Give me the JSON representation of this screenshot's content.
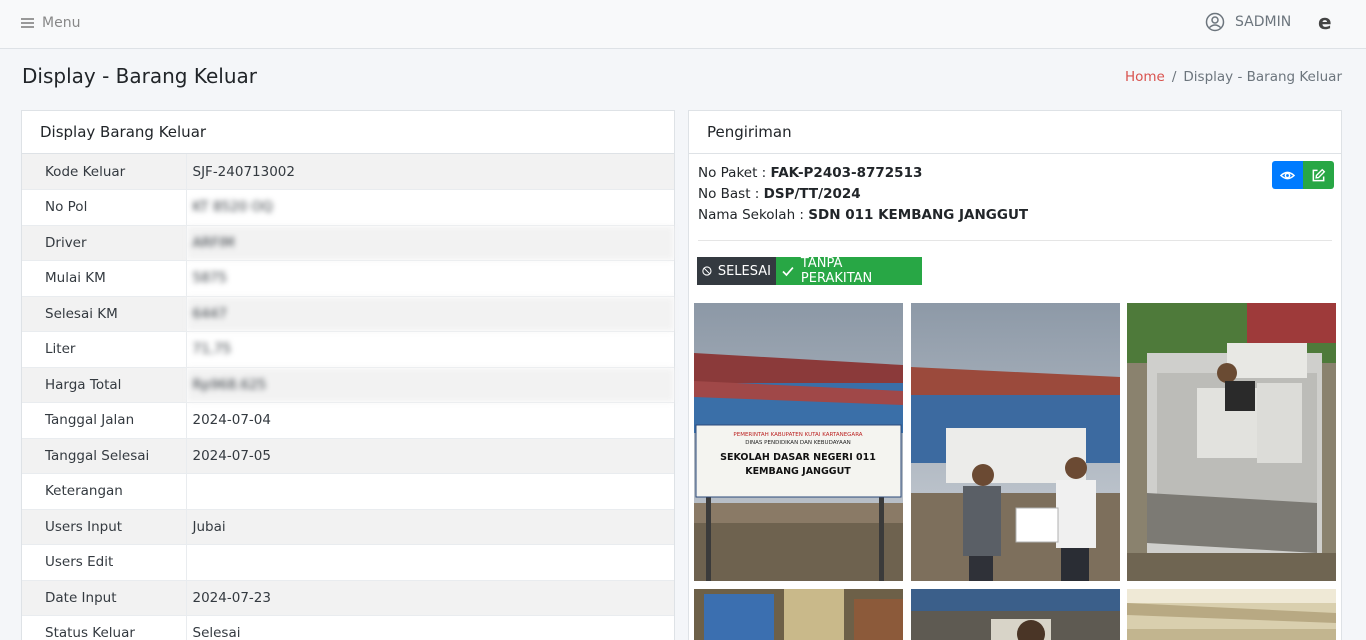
{
  "navbar": {
    "menu_label": "Menu",
    "user_name": "SADMIN",
    "brand_letter": "e"
  },
  "page": {
    "title": "Display - Barang Keluar"
  },
  "breadcrumb": {
    "home": "Home",
    "separator": "/",
    "current": "Display - Barang Keluar"
  },
  "left_card": {
    "header": "Display Barang Keluar",
    "rows": [
      {
        "label": "Kode Keluar",
        "value": "SJF-240713002"
      },
      {
        "label": "No Pol",
        "value": "KT 8520 OQ"
      },
      {
        "label": "Driver",
        "value": "ARFIM"
      },
      {
        "label": "Mulai KM",
        "value": "5875"
      },
      {
        "label": "Selesai KM",
        "value": "6447"
      },
      {
        "label": "Liter",
        "value": "71,75"
      },
      {
        "label": "Harga Total",
        "value": "Rp968.625"
      },
      {
        "label": "Tanggal Jalan",
        "value": "2024-07-04"
      },
      {
        "label": "Tanggal Selesai",
        "value": "2024-07-05"
      },
      {
        "label": "Keterangan",
        "value": ""
      },
      {
        "label": "Users Input",
        "value": "Jubai"
      },
      {
        "label": "Users Edit",
        "value": ""
      },
      {
        "label": "Date Input",
        "value": "2024-07-23"
      },
      {
        "label": "Status Keluar",
        "value": "Selesai"
      }
    ]
  },
  "right_card": {
    "header": "Pengiriman",
    "paket_label": "No Paket : ",
    "paket_value": "FAK-P2403-8772513",
    "bast_label": "No Bast : ",
    "bast_value": "DSP/TT/2024",
    "sekolah_label": "Nama Sekolah : ",
    "sekolah_value": "SDN 011 KEMBANG JANGGUT",
    "badge_status": "SELESAI",
    "badge_assembly": "TANPA PERAKITAN",
    "sign_lines": [
      "PEMERINTAH KABUPATEN KUTAI KARTANEGARA",
      "DINAS PENDIDIKAN DAN KEBUDAYAAN",
      "SEKOLAH DASAR NEGERI 011",
      "KEMBANG JANGGUT"
    ]
  },
  "colors": {
    "accent_red": "#d9534f",
    "blue": "#007bff",
    "green": "#28a745",
    "dark": "#343a40"
  },
  "icons": [
    "menu-icon",
    "user-circle-icon",
    "eye-icon",
    "edit-icon",
    "ban-icon",
    "check-icon"
  ]
}
